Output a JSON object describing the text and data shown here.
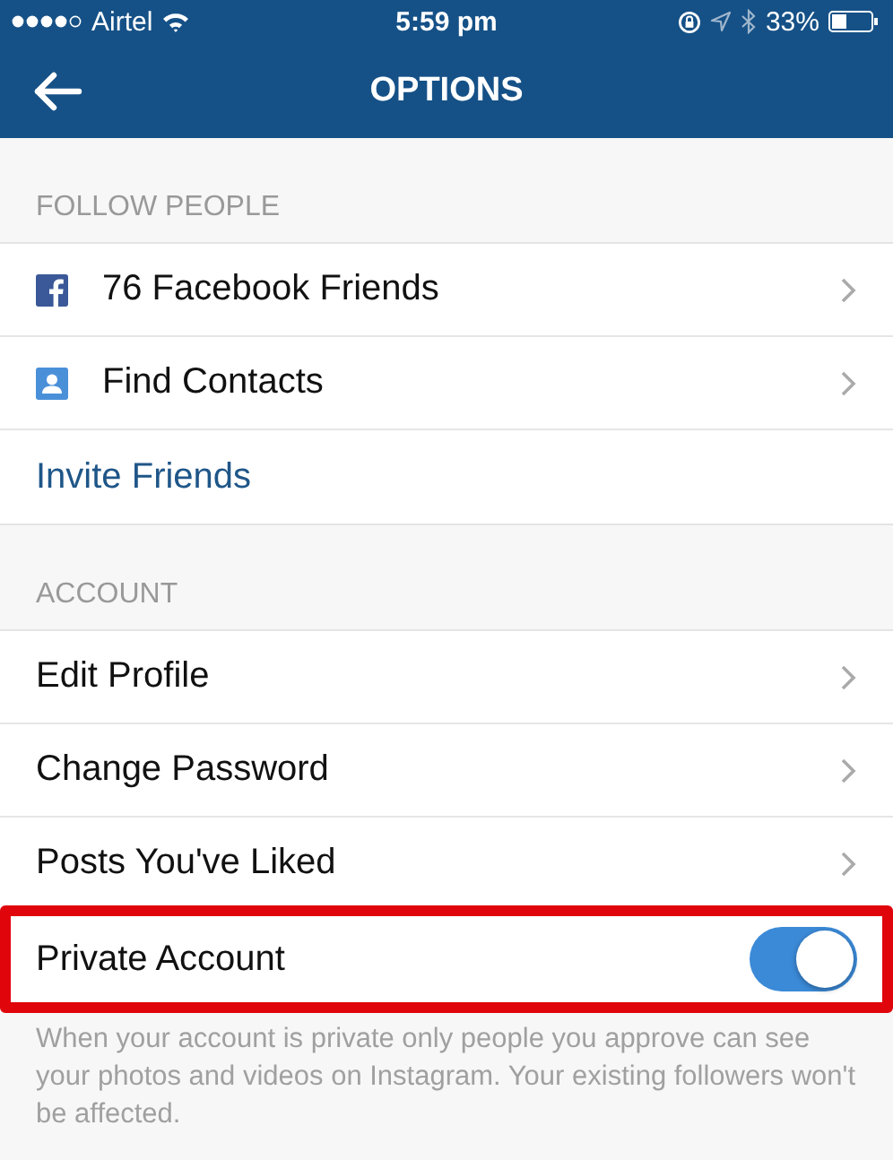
{
  "status_bar": {
    "carrier": "Airtel",
    "time": "5:59 pm",
    "battery": "33%"
  },
  "nav": {
    "title": "OPTIONS"
  },
  "sections": [
    {
      "header": "FOLLOW PEOPLE",
      "items": [
        {
          "kind": "facebook",
          "label": "76 Facebook Friends"
        },
        {
          "kind": "contacts",
          "label": "Find Contacts"
        },
        {
          "kind": "action",
          "label": "Invite Friends"
        }
      ]
    },
    {
      "header": "ACCOUNT",
      "items": [
        {
          "kind": "link",
          "label": "Edit Profile"
        },
        {
          "kind": "link",
          "label": "Change Password"
        },
        {
          "kind": "link",
          "label": "Posts You've Liked"
        },
        {
          "kind": "toggle",
          "label": "Private Account",
          "on": true,
          "highlighted": true
        }
      ],
      "footnote": "When your account is private only people you approve can see your photos and videos on Instagram. Your existing followers won't be affected."
    }
  ]
}
